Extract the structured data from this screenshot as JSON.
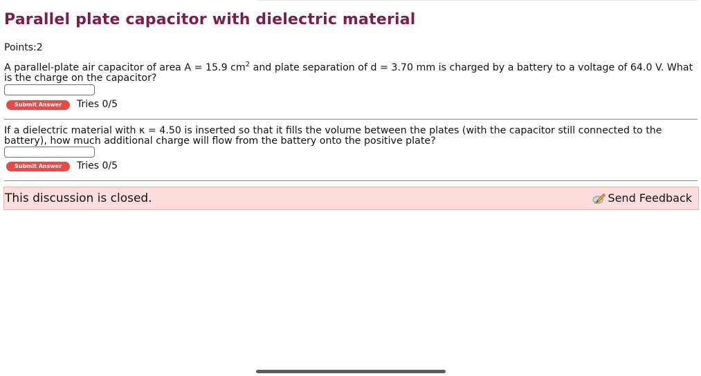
{
  "page": {
    "title": "Parallel plate capacitor with dielectric material",
    "points": "Points:2"
  },
  "questions": [
    {
      "text_before_sup": "A parallel-plate air capacitor of area A = 15.9 cm",
      "sup": "2",
      "text_after_sup": " and plate separation of d = 3.70 mm is charged by a battery to a voltage of 64.0 V. What is the charge on the capacitor?",
      "answer_value": "",
      "submit_label": "Submit Answer",
      "tries": "Tries 0/5"
    },
    {
      "text": "If a dielectric material with κ = 4.50 is inserted so that it fills the volume between the plates (with the capacitor still connected to the battery), how much additional charge will flow from the battery onto the positive plate?",
      "answer_value": "",
      "submit_label": "Submit Answer",
      "tries": "Tries 0/5"
    }
  ],
  "discussion": {
    "status": "This discussion is closed.",
    "feedback_label": "Send Feedback",
    "feedback_icon": "pencil-feedback-icon"
  },
  "colors": {
    "title": "#7a1e4e",
    "submit_button": "#e84a4a",
    "closed_background": "#fddddd",
    "closed_border": "#f0b0a4"
  }
}
